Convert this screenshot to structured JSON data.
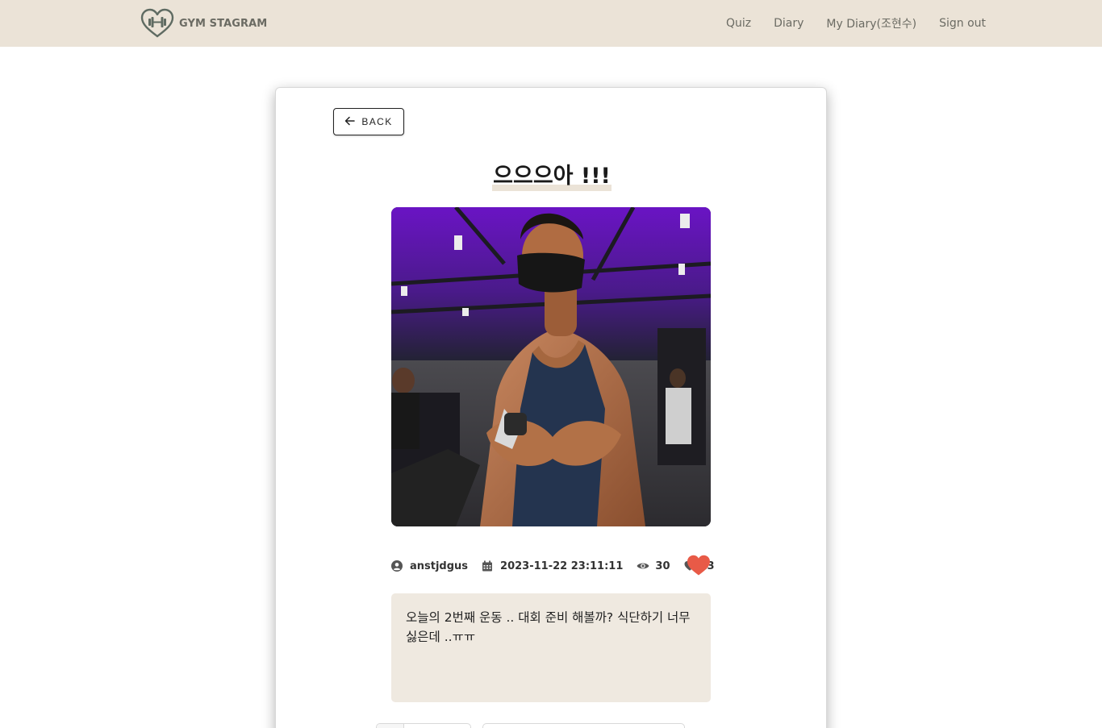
{
  "navbar": {
    "brand": "GYM STAGRAM",
    "links": [
      "Quiz",
      "Diary",
      "My Diary(조현수)",
      "Sign out"
    ]
  },
  "post": {
    "back_label": "BACK",
    "title": "으으으아 !!!",
    "author": "anstjdgus",
    "date": "2023-11-22 23:11:11",
    "views": "30",
    "likes": "13",
    "content": "오늘의 2번째 운동 .. 대회 준비 해볼까? 식단하기 너무 싫은데 ..ㅠㅠ"
  },
  "colors": {
    "navbar_bg": "#ebe3d7",
    "content_bg": "#efe9e0",
    "like_heart": "#e85a47"
  },
  "icons": {
    "brand": "heart-dumbbell-icon",
    "back": "arrow-left-icon",
    "author": "user-circle-icon",
    "date": "calendar-icon",
    "views": "eye-icon",
    "likes": "heart-icon",
    "like_button": "heart-icon"
  }
}
